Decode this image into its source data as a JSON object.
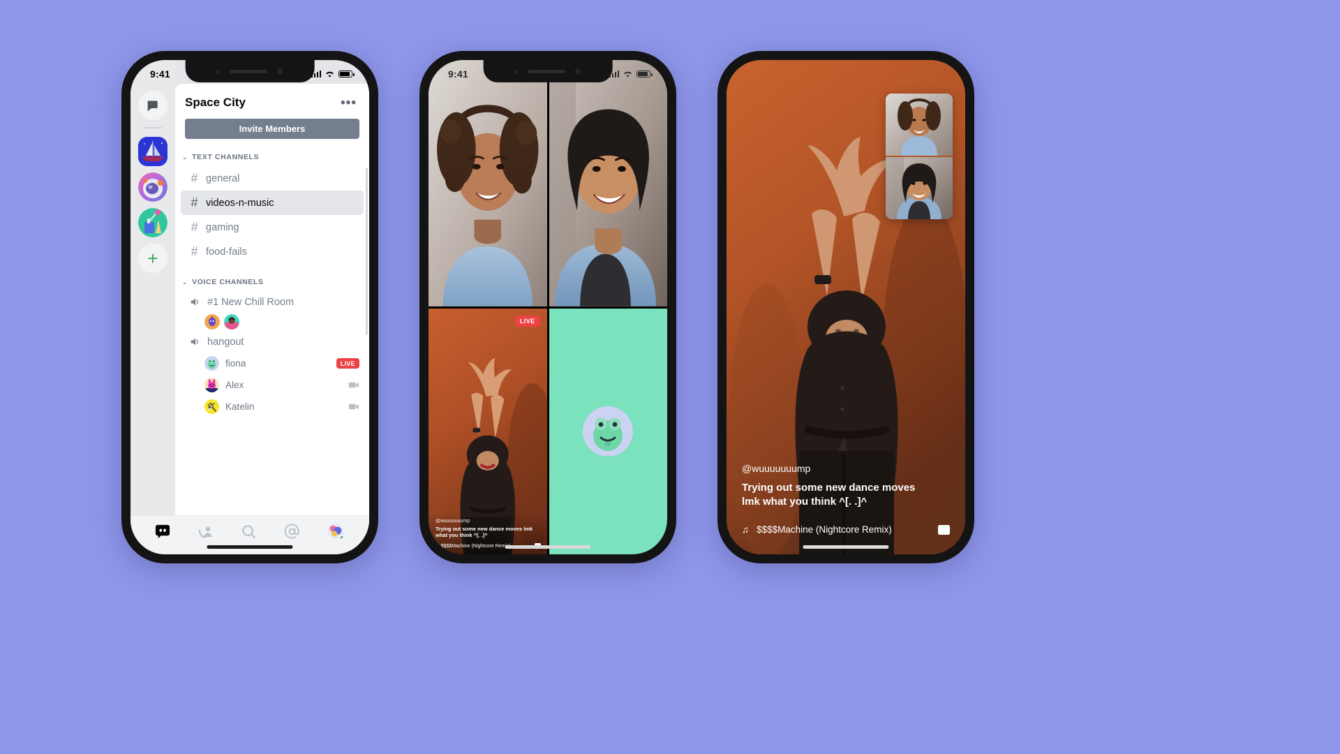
{
  "background_color": "#8e96ea",
  "phone1": {
    "status_bar": {
      "time": "9:41"
    },
    "guild_rail": [
      {
        "name": "direct-messages",
        "icon": "chat-bubble-icon"
      },
      {
        "name": "guild-sailboat",
        "icon": "sailboat-avatar"
      },
      {
        "name": "guild-astronaut",
        "icon": "astronaut-avatar"
      },
      {
        "name": "guild-paint",
        "icon": "paint-avatar"
      },
      {
        "name": "add-server",
        "icon": "plus-icon",
        "label": "+"
      }
    ],
    "server": {
      "title": "Space City",
      "more_label": "•••",
      "invite_label": "Invite Members"
    },
    "text_channels": {
      "header": "TEXT CHANNELS",
      "items": [
        {
          "name": "general",
          "active": false
        },
        {
          "name": "videos-n-music",
          "active": true
        },
        {
          "name": "gaming",
          "active": false
        },
        {
          "name": "food-fails",
          "active": false
        }
      ]
    },
    "voice_channels": {
      "header": "VOICE CHANNELS",
      "items": [
        {
          "name": "#1 New Chill Room",
          "avatars": 2,
          "members": []
        },
        {
          "name": "hangout",
          "avatars": 0,
          "members": [
            {
              "name": "fiona",
              "status": "LIVE",
              "badge": "live"
            },
            {
              "name": "Alex",
              "status": "",
              "badge": "camera"
            },
            {
              "name": "Katelin",
              "status": "",
              "badge": "camera"
            }
          ]
        }
      ]
    },
    "tab_bar": [
      {
        "name": "servers-tab",
        "icon": "discord-logo-icon"
      },
      {
        "name": "friends-tab",
        "icon": "friends-icon"
      },
      {
        "name": "search-tab",
        "icon": "search-icon"
      },
      {
        "name": "mentions-tab",
        "icon": "at-mention-icon"
      },
      {
        "name": "profile-tab",
        "icon": "user-avatar"
      }
    ]
  },
  "phone2": {
    "status_bar": {
      "time": "9:41"
    },
    "tiles": [
      {
        "name": "participant-video-1",
        "type": "person",
        "live": false
      },
      {
        "name": "participant-video-2",
        "type": "person",
        "live": false
      },
      {
        "name": "stream-video-dance",
        "type": "stream",
        "live": true,
        "live_label": "LIVE",
        "handle": "@wuuuuuuump",
        "caption": "Trying out some new dance moves lmk what you think ^[. .]^",
        "music": "$$$$Machine (Nightcore Remix)"
      },
      {
        "name": "participant-avatar-tile",
        "type": "avatar",
        "live": false,
        "background": "#7ae2bd"
      }
    ]
  },
  "phone3": {
    "handle": "@wuuuuuuump",
    "caption": "Trying out some new dance moves lmk what you think ^[. .]^",
    "music": "$$$$Machine (Nightcore Remix)",
    "pip": [
      {
        "name": "pip-participant-1"
      },
      {
        "name": "pip-participant-2"
      }
    ]
  },
  "colors": {
    "live_red": "#ed4245",
    "discord_blurple": "#5865f2",
    "mint": "#7ae2bd",
    "orange_bg": "#b85527",
    "invite_grey": "#747f8d",
    "page_bg": "#8e96ea"
  }
}
